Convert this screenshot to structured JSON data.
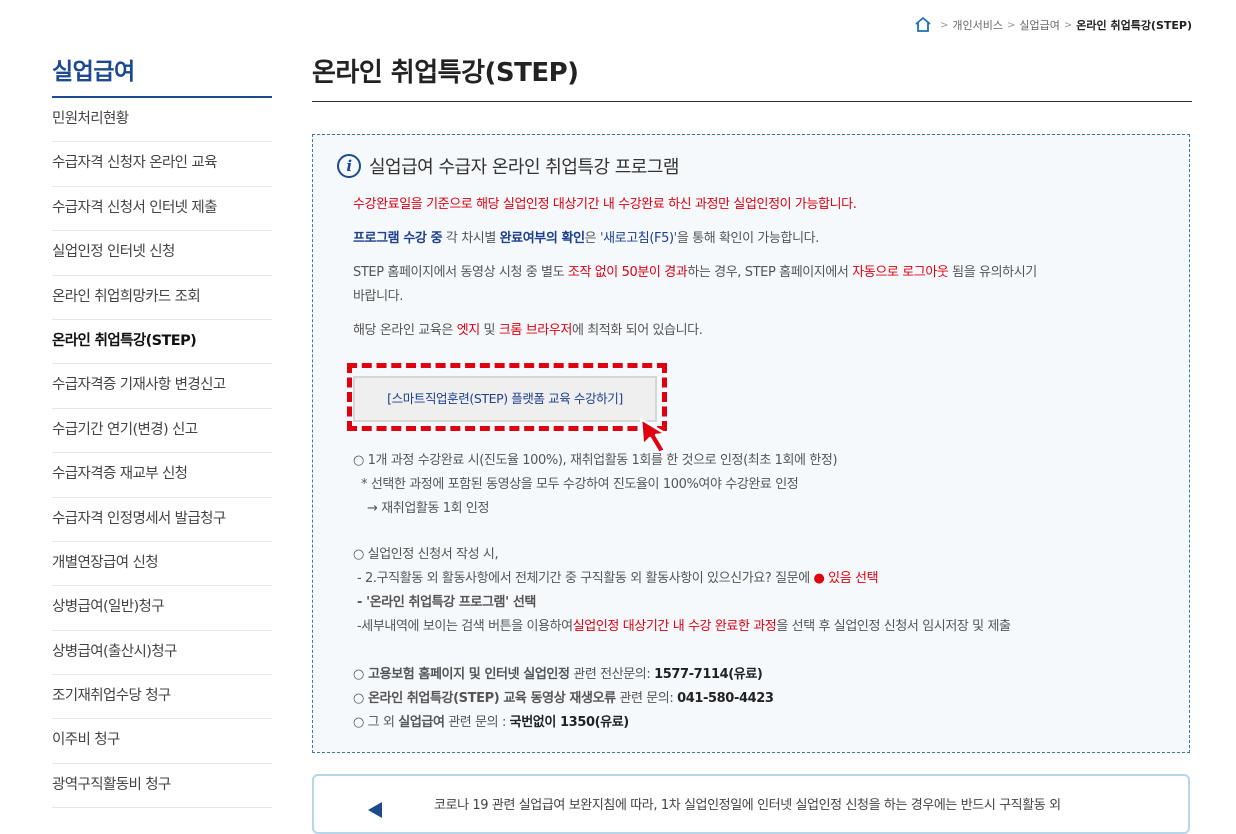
{
  "breadcrumb": {
    "items": [
      "개인서비스",
      "실업급여"
    ],
    "current": "온라인 취업특강(STEP)"
  },
  "sidebar": {
    "title": "실업급여",
    "items": [
      "민원처리현황",
      "수급자격 신청자 온라인 교육",
      "수급자격 신청서 인터넷 제출",
      "실업인정 인터넷 신청",
      "온라인 취업희망카드 조회",
      "온라인 취업특강(STEP)",
      "수급자격증 기재사항 변경신고",
      "수급기간 연기(변경) 신고",
      "수급자격증 재교부 신청",
      "수급자격 인정명세서 발급청구",
      "개별연장급여 신청",
      "상병급여(일반)청구",
      "상병급여(출산시)청구",
      "조기재취업수당 청구",
      "이주비 청구",
      "광역구직활동비 청구"
    ],
    "active_index": 5
  },
  "page": {
    "title": "온라인 취업특강(STEP)"
  },
  "info": {
    "title": "실업급여 수급자 온라인 취업특강 프로그램",
    "p1": "수강완료일을 기준으로 해당 실업인정 대상기간 내 수강완료 하신 과정만 실업인정이 가능합니다.",
    "p2a": "프로그램 수강 중",
    "p2b": " 각 차시별 ",
    "p2c": "완료여부의 확인",
    "p2d": "은 '",
    "p2e": "새로고침(F5)",
    "p2f": "'을 통해 확인이 가능합니다.",
    "p3a": "STEP 홈페이지에서 동영상 시청 중 별도 ",
    "p3b": "조작 없이 50분이 경과",
    "p3c": "하는 경우, STEP 홈페이지에서 ",
    "p3d": "자동으로 로그아웃",
    "p3e": " 됨을 유의하시기",
    "p3f": "바랍니다.",
    "p4a": "해당 온라인 교육은 ",
    "p4b": "엣지",
    "p4c": " 및 ",
    "p4d": "크롬 브라우저",
    "p4e": "에 최적화 되어 있습니다.",
    "step_button": "[스마트직업훈련(STEP) 플랫폼 교육 수강하기]",
    "l1": "○ 1개 과정 수강완료 시(진도율 100%), 재취업활동 1회를 한 것으로 인정(최초 1회에 한정)",
    "l2": "* 선택한 과정에 포함된 동영상을 모두 수강하여 진도율이 100%여야 수강완료 인정",
    "l3": "→ 재취업활동 1회 인정",
    "m1": "○ 실업인정 신청서 작성 시,",
    "m2a": "- 2.구직활동 외 활동사항에서 전체기간 중 구직활동 외 활동사항이 있으신가요? 질문에 ",
    "m2b": "●",
    "m2c": " 있음 선택",
    "m3": "- '온라인 취업특강 프로그램' 선택",
    "m4a": "-세부내역에 보이는 검색 버튼을 이용하여",
    "m4b": "실업인정 대상기간 내 수강 완료한 과정",
    "m4c": "을 선택 후 실업인정 신청서 임시저장 및 제출",
    "c1a": "○ 고용보험 홈페이지 및 인터넷 실업인정",
    "c1b": " 관련 전산문의: ",
    "c1c": "1577-7114(유료)",
    "c2a": "○ 온라인 취업특강(STEP) 교육 동영상 재생오류",
    "c2b": " 관련 문의: ",
    "c2c": "041-580-4423",
    "c3a": "○ 그 외 ",
    "c3b": "실업급여",
    "c3c": " 관련 문의 : ",
    "c3d": "국번없이 1350(유료)"
  },
  "notice": {
    "text": "코로나 19 관련 실업급여 보완지침에 따라, 1차 실업인정일에 인터넷 실업인정 신청을 하는 경우에는 반드시 구직활동 외"
  },
  "colors": {
    "accent": "#1d4a8e",
    "red": "#e0000f",
    "box_bg": "#f5f9fc"
  }
}
